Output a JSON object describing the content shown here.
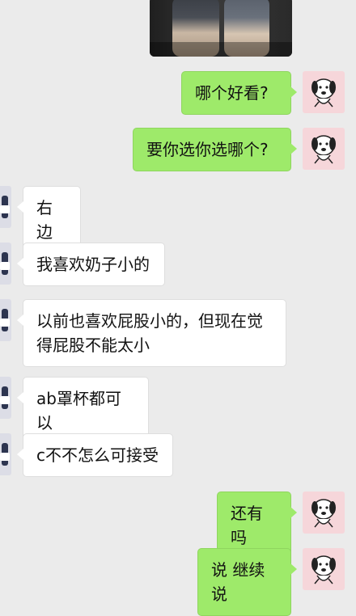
{
  "chat": {
    "messages": [
      {
        "side": "out",
        "text": "哪个好看?"
      },
      {
        "side": "out",
        "text": "要你选你选哪个?"
      },
      {
        "side": "in",
        "text": "右边"
      },
      {
        "side": "in",
        "text": "我喜欢奶子小的"
      },
      {
        "side": "in",
        "text": "以前也喜欢屁股小的，但现在觉得屁股不能太小"
      },
      {
        "side": "in",
        "text": "ab罩杯都可以"
      },
      {
        "side": "in",
        "text": "c不不怎么可接受"
      },
      {
        "side": "out",
        "text": "还有吗"
      },
      {
        "side": "out",
        "text": "说 继续说"
      }
    ]
  },
  "colors": {
    "background": "#ebebeb",
    "outgoing_bubble": "#9eea6a",
    "incoming_bubble": "#ffffff",
    "self_avatar_bg": "#f6d6da"
  },
  "icons": {
    "self_avatar": "cartoon-dog-avatar",
    "contact_avatar": "contact-photo-avatar"
  }
}
